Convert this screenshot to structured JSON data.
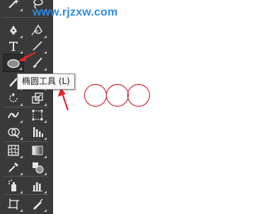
{
  "watermark": {
    "text": "www.rjzxw.com",
    "color": "#2a8ae8"
  },
  "tooltip": {
    "text": "椭圆工具 (L)"
  },
  "toolbar": {
    "tools": [
      {
        "name": "magic-wand-tool",
        "icon": "magic-wand-icon"
      },
      {
        "name": "lasso-tool",
        "icon": "lasso-icon"
      },
      {
        "name": "pen-tool",
        "icon": "pen-icon"
      },
      {
        "name": "curvature-tool",
        "icon": "curvature-pen-icon"
      },
      {
        "name": "type-tool",
        "icon": "type-T-icon"
      },
      {
        "name": "line-segment-tool",
        "icon": "line-icon"
      },
      {
        "name": "ellipse-tool",
        "icon": "ellipse-icon",
        "active": true
      },
      {
        "name": "paintbrush-tool",
        "icon": "brush-icon"
      },
      {
        "name": "pencil-tool",
        "icon": "pencil-icon"
      },
      {
        "name": "eraser-tool",
        "icon": "eraser-icon"
      },
      {
        "name": "rotate-tool",
        "icon": "rotate-icon"
      },
      {
        "name": "scale-tool",
        "icon": "scale-icon"
      },
      {
        "name": "width-tool",
        "icon": "width-icon"
      },
      {
        "name": "free-transform-tool",
        "icon": "free-transform-icon"
      },
      {
        "name": "shape-builder-tool",
        "icon": "shape-builder-icon"
      },
      {
        "name": "perspective-grid-tool",
        "icon": "perspective-grid-icon"
      },
      {
        "name": "mesh-tool",
        "icon": "mesh-icon"
      },
      {
        "name": "gradient-tool",
        "icon": "gradient-icon"
      },
      {
        "name": "eyedropper-tool",
        "icon": "eyedropper-icon"
      },
      {
        "name": "blend-tool",
        "icon": "blend-icon"
      },
      {
        "name": "symbol-sprayer-tool",
        "icon": "symbol-sprayer-icon"
      },
      {
        "name": "column-graph-tool",
        "icon": "column-graph-icon"
      },
      {
        "name": "artboard-tool",
        "icon": "artboard-icon"
      },
      {
        "name": "slice-tool",
        "icon": "slice-icon"
      }
    ]
  },
  "canvas": {
    "shape_stroke_color": "#d42b3a",
    "circle_count": 3
  },
  "annotation": {
    "arrow_color": "#e8262a"
  }
}
